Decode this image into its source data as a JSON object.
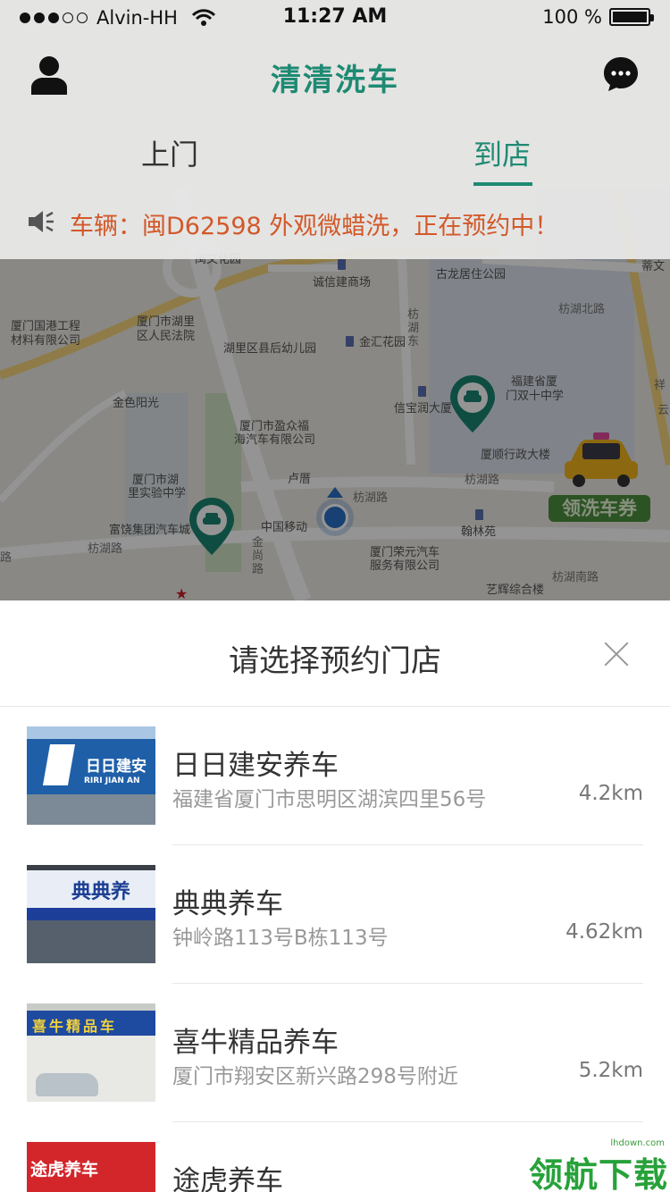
{
  "status_bar": {
    "carrier": "Alvin-HH",
    "time": "11:27 AM",
    "battery": "100 %"
  },
  "nav": {
    "title": "清清洗车",
    "user_icon": "user-icon",
    "message_icon": "chat-bubble-icon"
  },
  "tabs": [
    {
      "label": "上门",
      "active": false
    },
    {
      "label": "到店",
      "active": true
    }
  ],
  "notice": {
    "icon": "speaker-icon",
    "text": "车辆：闽D62598 外观微蜡洗，正在预约中！"
  },
  "map": {
    "labels": {
      "l01": "闽文化园",
      "l02": "古龙居住公园",
      "l03": "诚信建商场",
      "l04": "厦门国港工程",
      "l05": "材料有限公司",
      "l06": "厦门市湖里",
      "l07": "区人民法院",
      "l08": "湖里区县后幼儿园",
      "l09": "金汇花园",
      "l10": "枋",
      "l11": "湖",
      "l12": "东",
      "l13": "枋湖北路",
      "l14": "福建省厦",
      "l15": "门双十中学",
      "l16": "金色阳光",
      "l17": "信宝润大厦",
      "l18": "厦门市盈众福",
      "l19": "海汽车有限公司",
      "l20": "厦顺行政大楼",
      "l21": "枋湖路",
      "l22": "厦门市湖",
      "l23": "里实验中学",
      "l24": "卢厝",
      "l25": "枋湖路",
      "l26": "富饶集团汽车城",
      "l27": "中国移动",
      "l28": "翰林苑",
      "l29": "枋湖路",
      "l30": "厦门荣元汽车",
      "l31": "服务有限公司",
      "l32": "艺辉综合楼",
      "l33": "枋湖南路",
      "l34": "金",
      "l35": "尚",
      "l36": "路",
      "l37": "路",
      "l38": "祥",
      "l39": "云",
      "l40": "蒂文"
    },
    "coupon_label": "领洗车券"
  },
  "sheet": {
    "title": "请选择预约门店",
    "stores": [
      {
        "name": "日日建安养车",
        "address": "福建省厦门市思明区湖滨四里56号",
        "distance": "4.2km",
        "sign": "日日建安",
        "sign_sub": "RIRI JIAN AN"
      },
      {
        "name": "典典养车",
        "address": "钟岭路113号B栋113号",
        "distance": "4.62km",
        "sign": "典典养"
      },
      {
        "name": "喜牛精品养车",
        "address": "厦门市翔安区新兴路298号附近",
        "distance": "5.2km",
        "sign": "喜牛精品车"
      },
      {
        "name": "途虎养车",
        "address": "",
        "distance": "",
        "sign": "途虎养车"
      }
    ]
  },
  "watermark": {
    "small": "lhdown.com",
    "big": "领航下载"
  },
  "colors": {
    "brand_green": "#1f8a73",
    "notice_orange": "#d2592a"
  }
}
